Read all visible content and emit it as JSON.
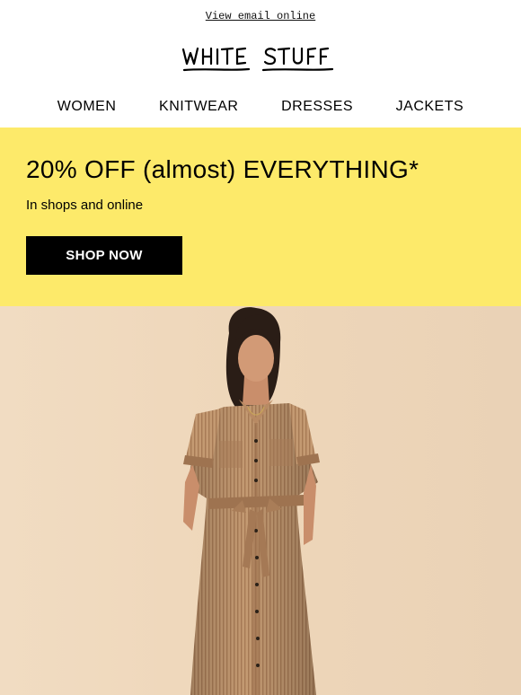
{
  "header": {
    "view_online_label": "View email online",
    "brand_logo_text": "WHITE STUFF"
  },
  "nav": {
    "items": [
      {
        "label": "WOMEN"
      },
      {
        "label": "KNITWEAR"
      },
      {
        "label": "DRESSES"
      },
      {
        "label": "JACKETS"
      }
    ]
  },
  "promo": {
    "title": "20% OFF (almost) EVERYTHING*",
    "subtitle": "In shops and online",
    "cta_label": "SHOP NOW",
    "background_color": "#fdea6a"
  },
  "hero": {
    "image": "model-in-striped-shirt-dress",
    "background_color": "#efd9bf"
  },
  "colors": {
    "text": "#000000",
    "button_bg": "#000000",
    "button_text": "#ffffff",
    "promo_bg": "#fdea6a"
  }
}
